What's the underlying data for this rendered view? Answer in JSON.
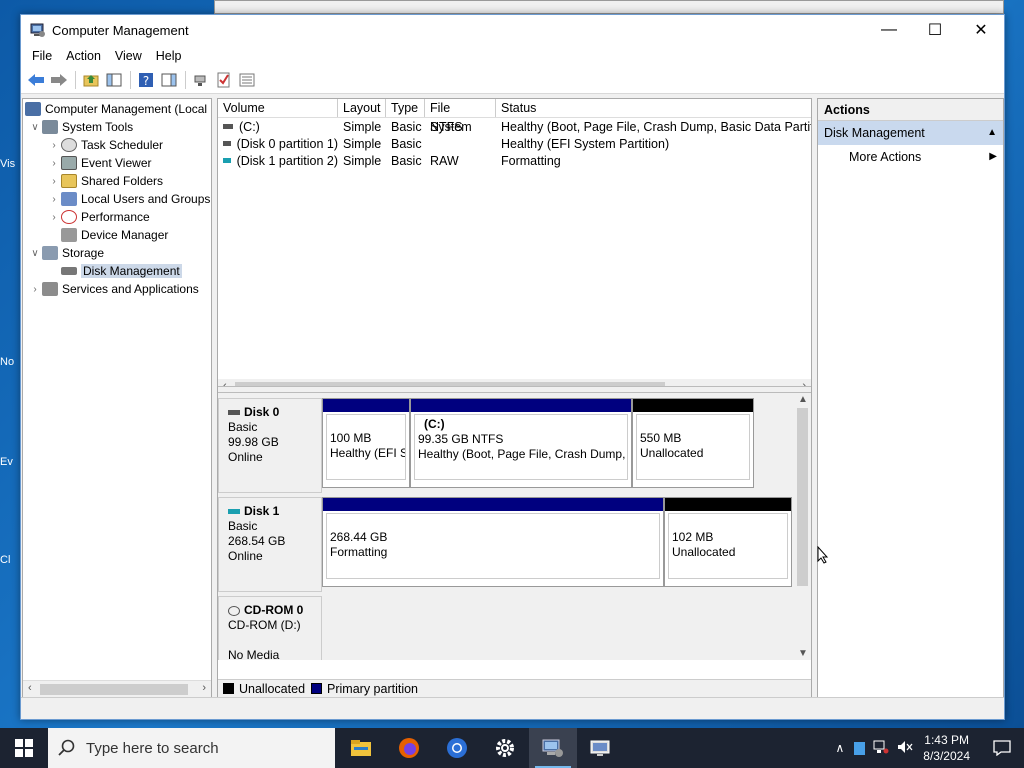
{
  "window": {
    "title": "Computer Management",
    "minimize": "—",
    "maximize": "☐",
    "close": "✕"
  },
  "menu": [
    "File",
    "Action",
    "View",
    "Help"
  ],
  "desktop_icons": [
    "Vis",
    "No",
    "Ev",
    "Cl"
  ],
  "tree": {
    "root": "Computer Management (Local",
    "items": [
      {
        "label": "System Tools",
        "expander": "∨"
      },
      {
        "label": "Task Scheduler",
        "expander": "›"
      },
      {
        "label": "Event Viewer",
        "expander": "›"
      },
      {
        "label": "Shared Folders",
        "expander": "›"
      },
      {
        "label": "Local Users and Groups",
        "expander": "›"
      },
      {
        "label": "Performance",
        "expander": "›"
      },
      {
        "label": "Device Manager",
        "expander": ""
      },
      {
        "label": "Storage",
        "expander": "∨"
      },
      {
        "label": "Disk Management",
        "expander": ""
      },
      {
        "label": "Services and Applications",
        "expander": "›"
      }
    ]
  },
  "volume_list": {
    "columns": [
      "Volume",
      "Layout",
      "Type",
      "File System",
      "Status"
    ],
    "rows": [
      {
        "volume": "(C:)",
        "layout": "Simple",
        "type": "Basic",
        "fs": "NTFS",
        "status": "Healthy (Boot, Page File, Crash Dump, Basic Data Partition)"
      },
      {
        "volume": "(Disk 0 partition 1)",
        "layout": "Simple",
        "type": "Basic",
        "fs": "",
        "status": "Healthy (EFI System Partition)"
      },
      {
        "volume": "(Disk 1 partition 2)",
        "layout": "Simple",
        "type": "Basic",
        "fs": "RAW",
        "status": "Formatting"
      }
    ]
  },
  "disks": [
    {
      "name": "Disk 0",
      "type": "Basic",
      "size": "99.98 GB",
      "state": "Online",
      "partitions": [
        {
          "title": "",
          "line1": "100 MB",
          "line2": "Healthy (EFI S",
          "color": "#00007f"
        },
        {
          "title": "(C:)",
          "line1": "99.35 GB NTFS",
          "line2": "Healthy (Boot, Page File, Crash Dump, I",
          "color": "#00007f"
        },
        {
          "title": "",
          "line1": "550 MB",
          "line2": "Unallocated",
          "color": "#000000"
        }
      ]
    },
    {
      "name": "Disk 1",
      "type": "Basic",
      "size": "268.54 GB",
      "state": "Online",
      "partitions": [
        {
          "title": "",
          "line1": "268.44 GB",
          "line2": "Formatting",
          "color": "#00007f"
        },
        {
          "title": "",
          "line1": "102 MB",
          "line2": "Unallocated",
          "color": "#000000"
        }
      ]
    },
    {
      "name": "CD-ROM 0",
      "type": "CD-ROM (D:)",
      "size": "",
      "state": "No Media"
    }
  ],
  "legend": [
    {
      "label": "Unallocated",
      "color": "#000000"
    },
    {
      "label": "Primary partition",
      "color": "#00007f"
    }
  ],
  "actions": {
    "header": "Actions",
    "section": "Disk Management",
    "items": [
      "More Actions"
    ]
  },
  "taskbar": {
    "search_placeholder": "Type here to search",
    "time": "1:43 PM",
    "date": "8/3/2024"
  }
}
